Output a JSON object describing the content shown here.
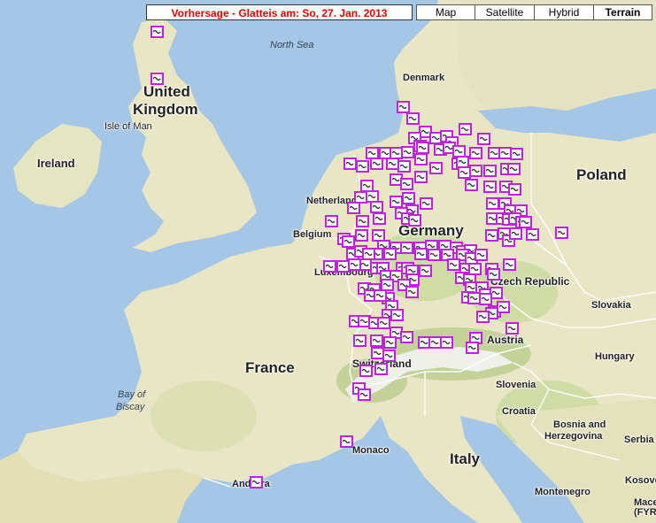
{
  "header": {
    "title": "Vorhersage - Glatteis am: So, 27. Jan. 2013"
  },
  "map_types": [
    {
      "label": "Map",
      "active": false
    },
    {
      "label": "Satellite",
      "active": false
    },
    {
      "label": "Hybrid",
      "active": false
    },
    {
      "label": "Terrain",
      "active": true
    }
  ],
  "labels": {
    "north_sea": "North Sea",
    "uk_line1": "United",
    "uk_line2": "Kingdom",
    "isle_of_man": "Isle of Man",
    "ireland": "Ireland",
    "denmark": "Denmark",
    "netherlands": "Netherlands",
    "belgium": "Belgium",
    "luxembourg": "Luxembourg",
    "germany": "Germany",
    "poland": "Poland",
    "czech": "Czech Republic",
    "slovakia": "Slovakia",
    "france": "France",
    "bay_line1": "Bay of",
    "bay_line2": "Biscay",
    "switzerland": "Switzerland",
    "austria": "Austria",
    "hungary": "Hungary",
    "slovenia": "Slovenia",
    "croatia": "Croatia",
    "bosnia_line1": "Bosnia and",
    "bosnia_line2": "Herzegovina",
    "serbia": "Serbia",
    "italy": "Italy",
    "monaco": "Monaco",
    "andorra": "Andorra",
    "montenegro": "Montenegro",
    "kosovo": "Kosovo",
    "macedonia": "Mace (FYR)"
  },
  "colors": {
    "sea": "#a6c6e6",
    "land": "#e8e6c4",
    "green": "#c9d8a0",
    "marker_border": "#c020e0"
  },
  "markers": {
    "icon": "ice-warning-icon",
    "count": 180
  }
}
